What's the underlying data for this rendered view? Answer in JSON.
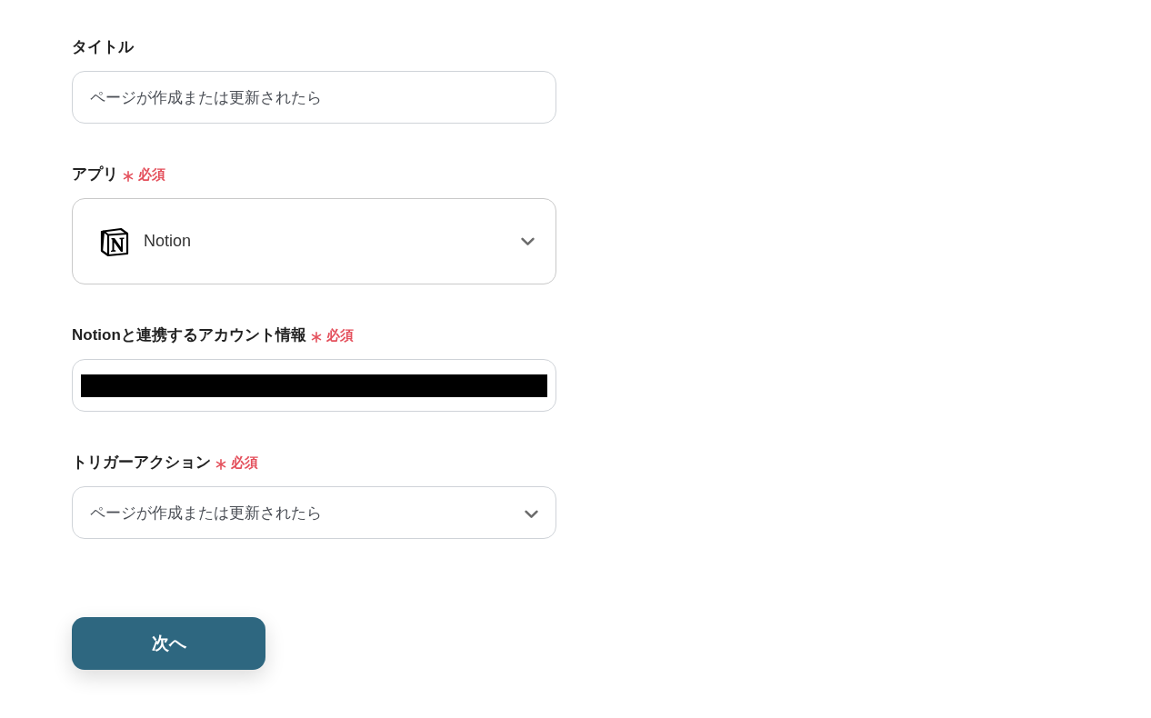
{
  "fields": [
    {
      "kind": "text",
      "label": "タイトル",
      "required": false,
      "value": "ページが作成または更新されたら"
    },
    {
      "kind": "app_select",
      "label": "アプリ",
      "required": true,
      "required_label": "必須",
      "value": "Notion"
    },
    {
      "kind": "redacted",
      "label": "Notionと連携するアカウント情報",
      "required": true,
      "required_label": "必須"
    },
    {
      "kind": "select",
      "label": "トリガーアクション",
      "required": true,
      "required_label": "必須",
      "value": "ページが作成または更新されたら"
    }
  ],
  "next_button": {
    "label": "次へ"
  }
}
